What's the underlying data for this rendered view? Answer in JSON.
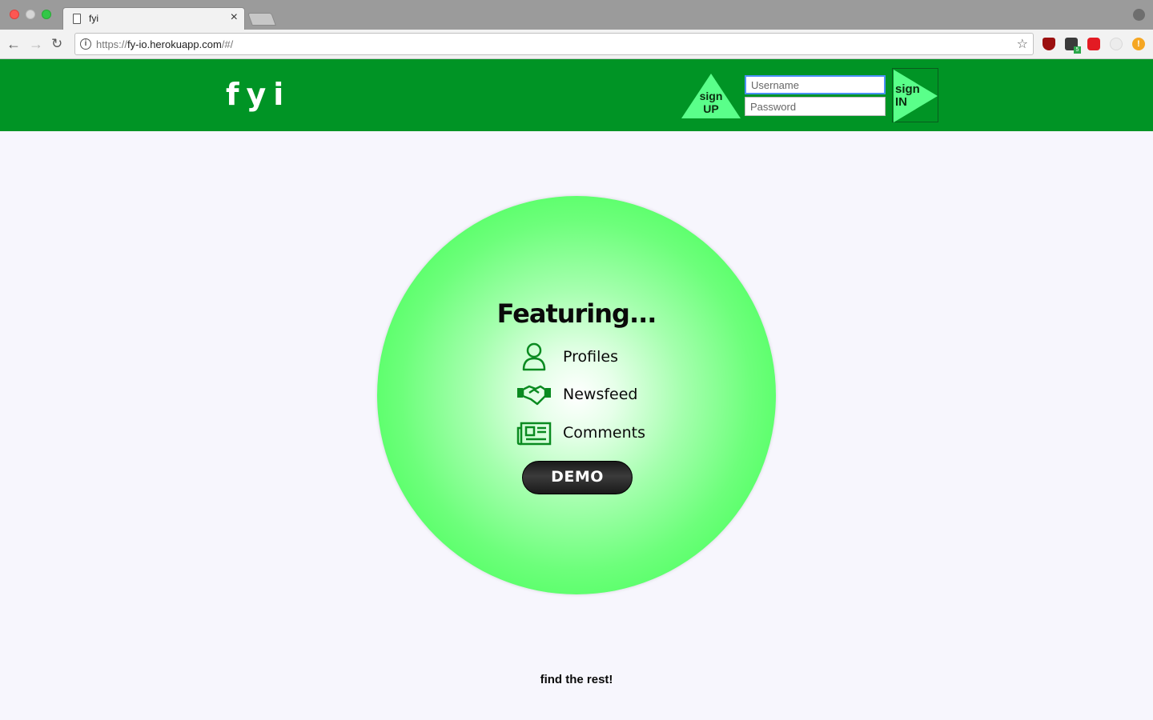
{
  "browser": {
    "tab_title": "fyi",
    "tab_close": "×",
    "url_prefix": "https://",
    "url_host": "fy-io.herokuapp.com",
    "url_path": "/#/",
    "extension_badge": "5",
    "alert_glyph": "!"
  },
  "header": {
    "logo": "fyi",
    "signup_line1": "sign",
    "signup_line2": "UP",
    "username_placeholder": "Username",
    "password_placeholder": "Password",
    "signin_line1": "sign",
    "signin_line2": "IN",
    "colors": {
      "header_bg": "#009425",
      "triangle": "#5aff8a"
    }
  },
  "main": {
    "featuring_title": "Featuring...",
    "features": [
      {
        "label": "Profiles",
        "icon": "user-profile-icon"
      },
      {
        "label": "Newsfeed",
        "icon": "handshake-icon"
      },
      {
        "label": "Comments",
        "icon": "newspaper-icon"
      }
    ],
    "demo_label": "DEMO",
    "colors": {
      "circle_edge": "#44ff56",
      "icon_green": "#0a8a20"
    }
  },
  "footer": {
    "find_rest": "find the rest!"
  }
}
